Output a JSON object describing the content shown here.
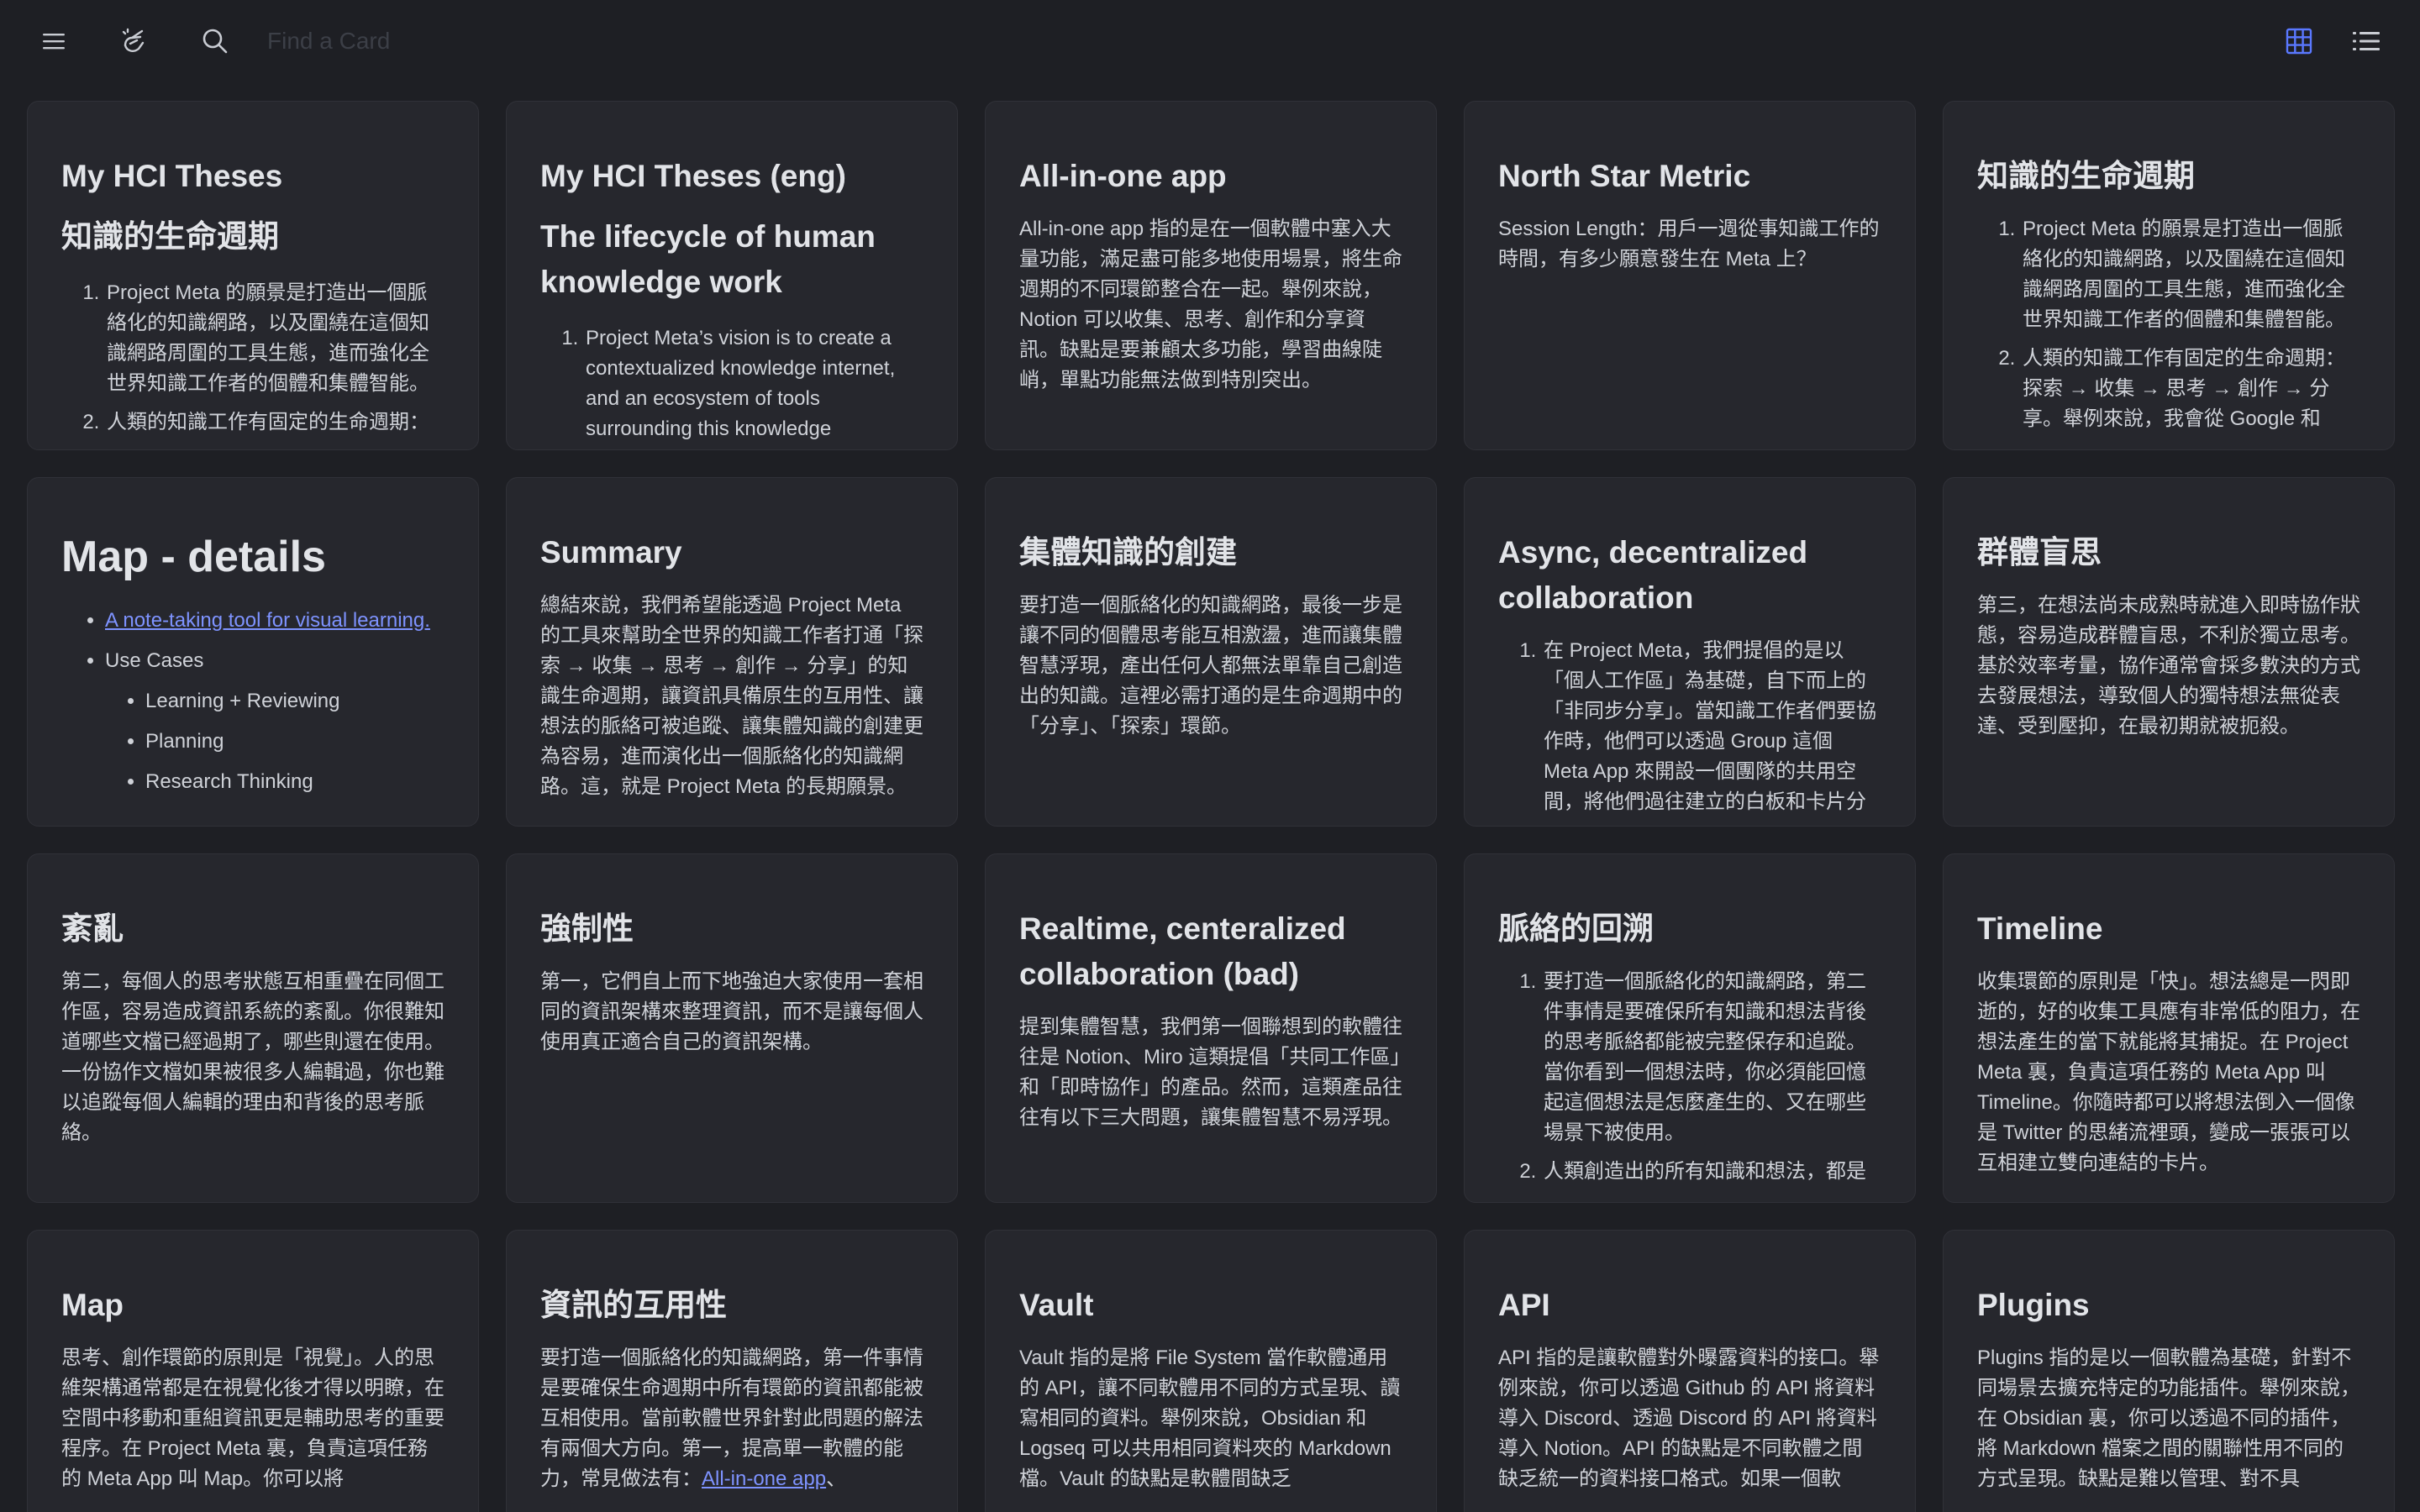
{
  "topbar": {
    "search_placeholder": "Find a Card"
  },
  "icons": {
    "menu": "menu-icon",
    "brand": "hand-sparkle-icon",
    "search": "search-icon",
    "grid_view": "grid-view-icon",
    "list_view": "list-view-icon"
  },
  "colors": {
    "background": "#1e1f24",
    "card": "#26272d",
    "accent": "#5a78ff",
    "link": "#7e93ff"
  },
  "cards": {
    "c1": {
      "title": "My HCI Theses",
      "subtitle": "知識的生命週期",
      "items": [
        "Project Meta 的願景是打造出一個脈絡化的知識網路，以及圍繞在這個知識網路周圍的工具生態，進而強化全世界知識工作者的個體和集體智能。",
        "人類的知識工作有固定的生命週期："
      ]
    },
    "c2": {
      "title": "My HCI Theses (eng)",
      "subtitle": "The lifecycle of human knowledge work",
      "items": [
        "Project Meta’s vision is to create a contextualized knowledge internet, and an ecosystem of tools surrounding this knowledge"
      ]
    },
    "c3": {
      "title": "All-in-one app",
      "text": "All-in-one app 指的是在一個軟體中塞入大量功能，滿足盡可能多地使用場景，將生命週期的不同環節整合在一起。舉例來說，Notion 可以收集、思考、創作和分享資訊。缺點是要兼顧太多功能，學習曲線陡峭，單點功能無法做到特別突出。"
    },
    "c4": {
      "title": "North Star Metric",
      "text": "Session Length：用戶一週從事知識工作的時間，有多少願意發生在 Meta 上？"
    },
    "c5": {
      "title": "知識的生命週期",
      "items": [
        "Project Meta 的願景是打造出一個脈絡化的知識網路，以及圍繞在這個知識網路周圍的工具生態，進而強化全世界知識工作者的個體和集體智能。",
        "人類的知識工作有固定的生命週期：探索 → 收集 → 思考 → 創作 → 分享。舉例來說，我會從 Google 和"
      ]
    },
    "c6": {
      "title": "Map - details",
      "link": "A note-taking tool for visual learning.",
      "use_cases": "Use Cases",
      "sub_items": [
        "Learning + Reviewing",
        "Planning",
        "Research Thinking"
      ]
    },
    "c7": {
      "title": "Summary",
      "text": "總結來說，我們希望能透過 Project Meta 的工具來幫助全世界的知識工作者打通「探索 → 收集 → 思考 → 創作 → 分享」的知識生命週期，讓資訊具備原生的互用性、讓想法的脈絡可被追蹤、讓集體知識的創建更為容易，進而演化出一個脈絡化的知識網路。這，就是 Project Meta 的長期願景。"
    },
    "c8": {
      "title": "集體知識的創建",
      "text": "要打造一個脈絡化的知識網路，最後一步是讓不同的個體思考能互相激盪，進而讓集體智慧浮現，產出任何人都無法單靠自己創造出的知識。這裡必需打通的是生命週期中的「分享」、「探索」環節。"
    },
    "c9": {
      "title": "Async, decentralized collaboration",
      "items": [
        "在 Project Meta，我們提倡的是以「個人工作區」為基礎，自下而上的「非同步分享」。當知識工作者們要協作時，他們可以透過 Group 這個 Meta App 來開設一個團隊的共用空間，將他們過往建立的白板和卡片分"
      ]
    },
    "c10": {
      "title": "群體盲思",
      "text": "第三，在想法尚未成熟時就進入即時協作狀態，容易造成群體盲思，不利於獨立思考。基於效率考量，協作通常會採多數決的方式去發展想法，導致個人的獨特想法無從表達、受到壓抑，在最初期就被扼殺。"
    },
    "c11": {
      "title": "紊亂",
      "text": "第二，每個人的思考狀態互相重疊在同個工作區，容易造成資訊系統的紊亂。你很難知道哪些文檔已經過期了，哪些則還在使用。一份協作文檔如果被很多人編輯過，你也難以追蹤每個人編輯的理由和背後的思考脈絡。"
    },
    "c12": {
      "title": "強制性",
      "text": "第一，它們自上而下地強迫大家使用一套相同的資訊架構來整理資訊，而不是讓每個人使用真正適合自己的資訊架構。"
    },
    "c13": {
      "title": "Realtime, centeralized collaboration (bad)",
      "text": "提到集體智慧，我們第一個聯想到的軟體往往是 Notion、Miro 這類提倡「共同工作區」和「即時協作」的產品。然而，這類產品往往有以下三大問題，讓集體智慧不易浮現。"
    },
    "c14": {
      "title": "脈絡的回溯",
      "items": [
        "要打造一個脈絡化的知識網路，第二件事情是要確保所有知識和想法背後的思考脈絡都能被完整保存和追蹤。當你看到一個想法時，你必須能回憶起這個想法是怎麼產生的、又在哪些場景下被使用。",
        "人類創造出的所有知識和想法，都是"
      ]
    },
    "c15": {
      "title": "Timeline",
      "text": "收集環節的原則是「快」。想法總是一閃即逝的，好的收集工具應有非常低的阻力，在想法產生的當下就能將其捕捉。在 Project Meta 裏，負責這項任務的 Meta App 叫 Timeline。你隨時都可以將想法倒入一個像是 Twitter 的思緒流裡頭，變成一張張可以互相建立雙向連結的卡片。"
    },
    "c16": {
      "title": "Map",
      "text": "思考、創作環節的原則是「視覺」。人的思維架構通常都是在視覺化後才得以明瞭，在空間中移動和重組資訊更是輔助思考的重要程序。在 Project Meta 裏，負責這項任務的 Meta App 叫 Map。你可以將"
    },
    "c17": {
      "title": "資訊的互用性",
      "text_before": "要打造一個脈絡化的知識網路，第一件事情是要確保生命週期中所有環節的資訊都能被互相使用。當前軟體世界針對此問題的解法有兩個大方向。第一，提高單一軟體的能力，常見做法有：",
      "link": "All-in-one app",
      "text_after": "、"
    },
    "c18": {
      "title": "Vault",
      "text": "Vault 指的是將 File System 當作軟體通用的 API，讓不同軟體用不同的方式呈現、讀寫相同的資料。舉例來說，Obsidian 和 Logseq 可以共用相同資料夾的 Markdown 檔。Vault 的缺點是軟體間缺乏"
    },
    "c19": {
      "title": "API",
      "text": "API 指的是讓軟體對外曝露資料的接口。舉例來說，你可以透過 Github 的 API 將資料導入 Discord、透過 Discord 的 API 將資料導入 Notion。API 的缺點是不同軟體之間缺乏統一的資料接口格式。如果一個軟"
    },
    "c20": {
      "title": "Plugins",
      "text": "Plugins 指的是以一個軟體為基礎，針對不同場景去擴充特定的功能插件。舉例來說，在 Obsidian 裏，你可以透過不同的插件，將 Markdown 檔案之間的關聯性用不同的方式呈現。缺點是難以管理、對不具"
    }
  }
}
